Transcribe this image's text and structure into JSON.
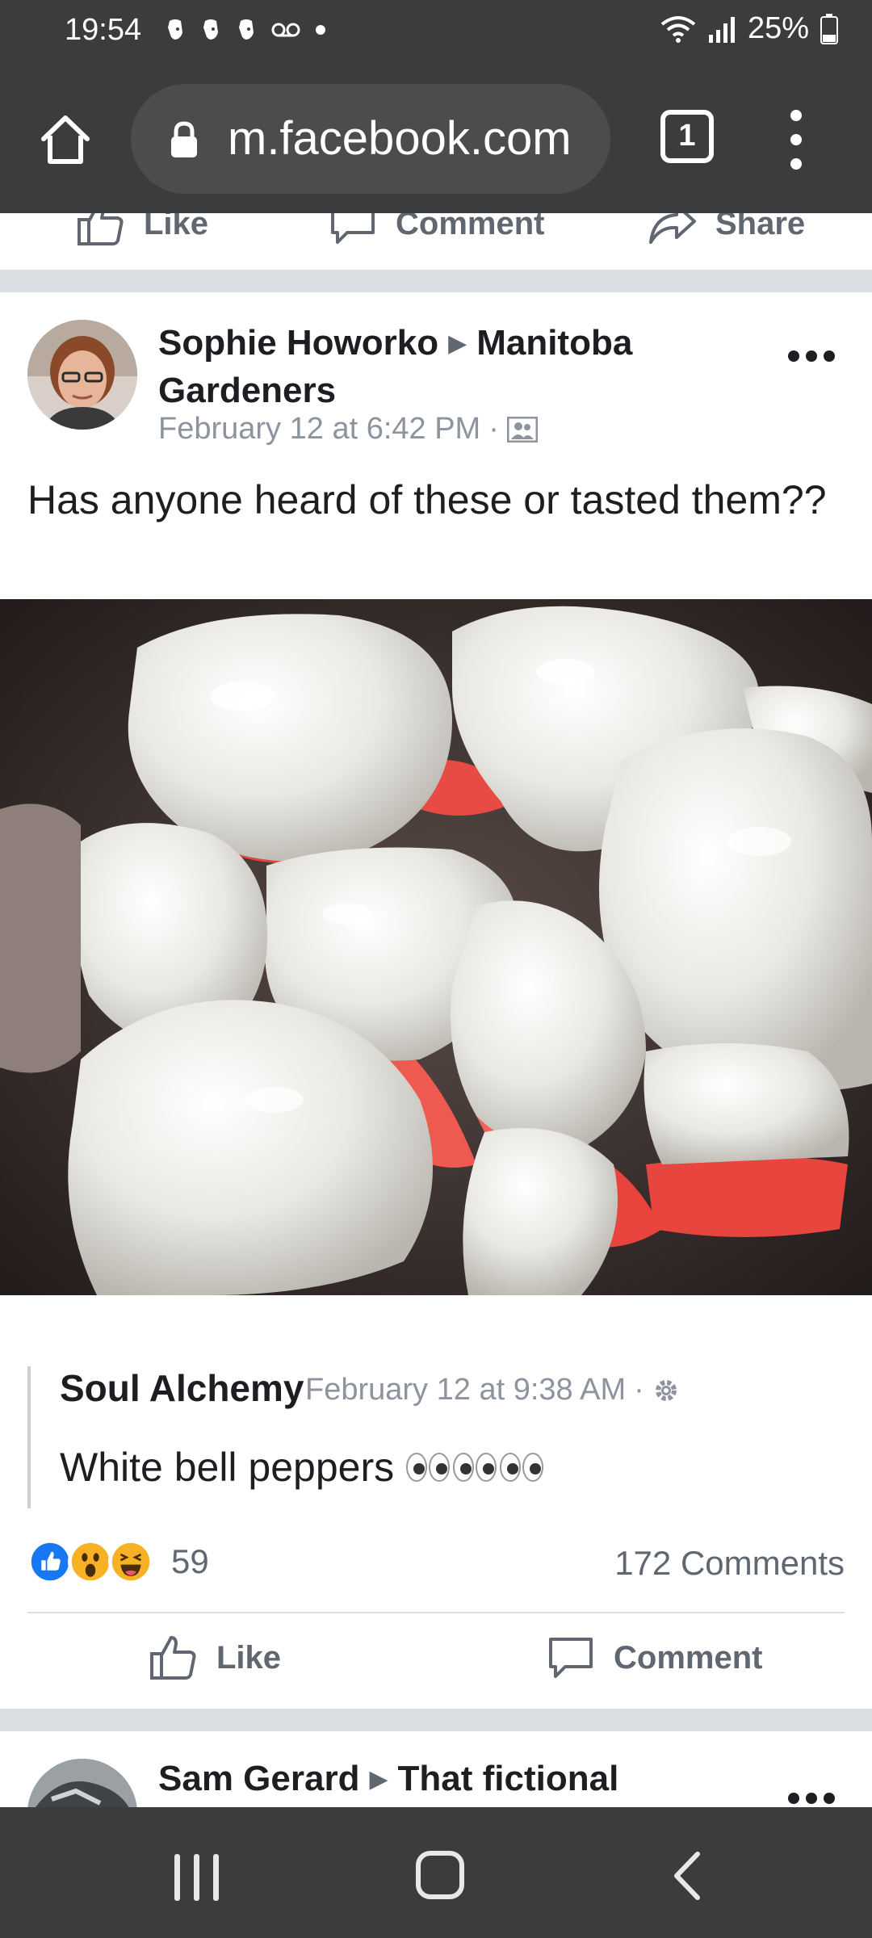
{
  "status_bar": {
    "time": "19:54",
    "notification_icons": [
      "evernote-icon",
      "evernote-icon",
      "evernote-icon",
      "voicemail-icon",
      "dot-icon"
    ],
    "battery": "25%"
  },
  "browser": {
    "url": "m.facebook.com",
    "tab_count": "1"
  },
  "previous_post_actions": {
    "like": "Like",
    "comment": "Comment",
    "share": "Share"
  },
  "post": {
    "author": "Sophie Howorko",
    "group": "Manitoba Gardeners",
    "timestamp": "February 12 at 6:42 PM",
    "meta_separator": "·",
    "text": "Has anyone heard of these or tasted them??",
    "top_comment": {
      "author": "Soul Alchemy",
      "timestamp": "February 12 at 9:38 AM",
      "meta_separator": "·",
      "text": "White bell peppers"
    },
    "reaction_icons": [
      "like-reaction",
      "wow-reaction",
      "haha-reaction"
    ],
    "reaction_count": "59",
    "comments_count": "172 Comments",
    "actions": {
      "like": "Like",
      "comment": "Comment"
    }
  },
  "next_post": {
    "author": "Sam Gerard",
    "group": "That fictional"
  },
  "colors": {
    "bar_background": "#3b3c3e",
    "separator": "#dadde1",
    "meta_text": "#8d949e",
    "like_blue": "#1877f2",
    "reaction_yellow": "#f7b125"
  }
}
